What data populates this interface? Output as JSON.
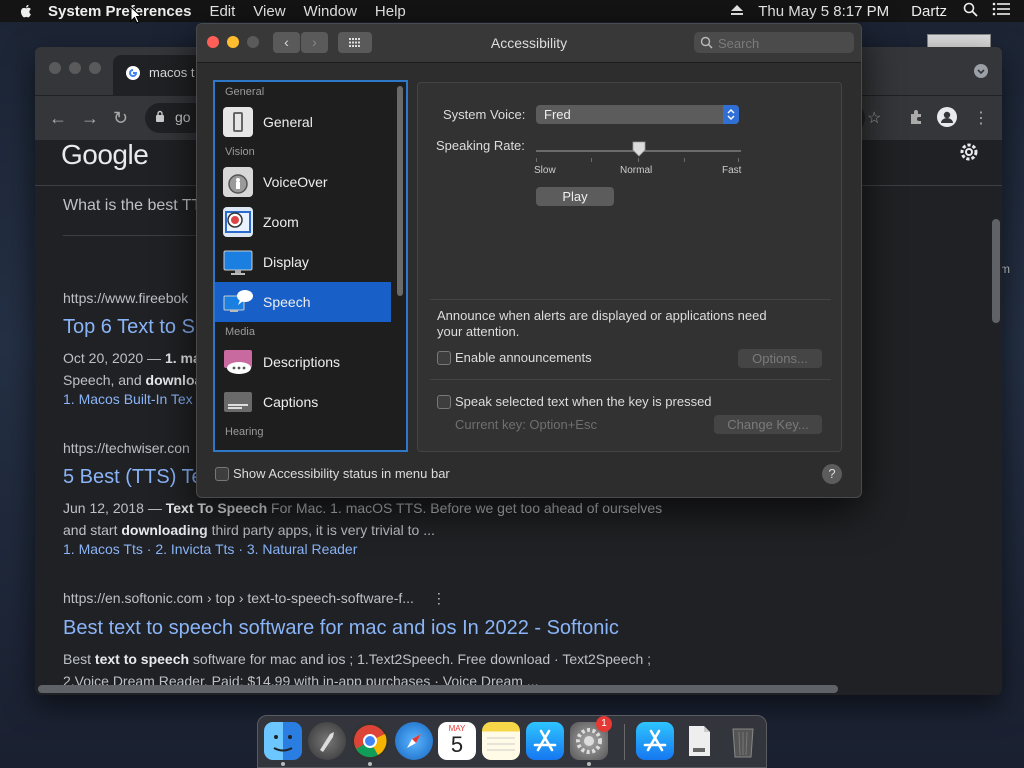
{
  "menubar": {
    "app_name": "System Preferences",
    "items": [
      "Edit",
      "View",
      "Window",
      "Help"
    ],
    "clock": "Thu May 5  8:17 PM",
    "user": "Dartz"
  },
  "browser": {
    "tab_title": "macos t",
    "url": "go",
    "logo": "Google",
    "search_query": "What is the best TT",
    "results": [
      {
        "url": "https://www.fireebok",
        "title": "Top 6 Text to S",
        "snippet_1": "Oct 20, 2020 — 1. ma",
        "snippet_2": "Speech, and downloa",
        "links": "1. Macos Built-In Tex"
      },
      {
        "url": "https://techwiser.con",
        "title": "5 Best (TTS) Te",
        "snippet_1": "Jun 12, 2018 — Text To Speech For Mac. 1. macOS TTS. Before we get too ahead of ourselves",
        "snippet_2": "and start downloading third party apps, it is very trivial to ...",
        "links": "1. Macos Tts · 2. Invicta Tts · 3. Natural Reader"
      },
      {
        "url": "https://en.softonic.com › top › text-to-speech-software-f...",
        "title": "Best text to speech software for mac and ios In 2022 - Softonic",
        "snippet_1": "Best text to speech software for mac and ios ; 1.Text2Speech. Free download · Text2Speech ;",
        "snippet_2": "2.Voice Dream Reader. Paid: $14.99 with in-app purchases · Voice Dream ..."
      }
    ],
    "right_edge_text": "m"
  },
  "prefs": {
    "title": "Accessibility",
    "search_placeholder": "Search",
    "sidebar": [
      {
        "type": "section",
        "label": "General"
      },
      {
        "type": "item",
        "label": "General",
        "icon": "general-icon"
      },
      {
        "type": "section",
        "label": "Vision"
      },
      {
        "type": "item",
        "label": "VoiceOver",
        "icon": "voiceover-icon"
      },
      {
        "type": "item",
        "label": "Zoom",
        "icon": "zoom-icon"
      },
      {
        "type": "item",
        "label": "Display",
        "icon": "display-icon"
      },
      {
        "type": "item",
        "label": "Speech",
        "icon": "speech-icon",
        "selected": true
      },
      {
        "type": "section",
        "label": "Media"
      },
      {
        "type": "item",
        "label": "Descriptions",
        "icon": "descriptions-icon"
      },
      {
        "type": "item",
        "label": "Captions",
        "icon": "captions-icon"
      },
      {
        "type": "section",
        "label": "Hearing"
      }
    ],
    "system_voice_label": "System Voice:",
    "system_voice_value": "Fred",
    "speaking_rate_label": "Speaking Rate:",
    "speaking_rate_position": 0.5,
    "rate_slow": "Slow",
    "rate_normal": "Normal",
    "rate_fast": "Fast",
    "play_label": "Play",
    "announce_text_1": "Announce when alerts are displayed or applications need",
    "announce_text_2": "your attention.",
    "enable_announcements": "Enable announcements",
    "options_label": "Options...",
    "speak_selected": "Speak selected text when the key is pressed",
    "current_key": "Current key: Option+Esc",
    "change_key_label": "Change Key...",
    "status_menu_label": "Show Accessibility status in menu bar",
    "help_label": "?"
  },
  "dock": {
    "apps": [
      "finder-icon",
      "launchpad-icon",
      "chrome-icon",
      "safari-icon",
      "calendar-icon",
      "notes-icon",
      "app-store-icon",
      "system-preferences-icon",
      "app-store-downloads-icon",
      "file-icon",
      "trash-icon"
    ],
    "calendar_month": "MAY",
    "calendar_day": "5",
    "badge": "1"
  },
  "colors": {
    "accent": "#1860c8",
    "link": "#8ab4f8"
  }
}
